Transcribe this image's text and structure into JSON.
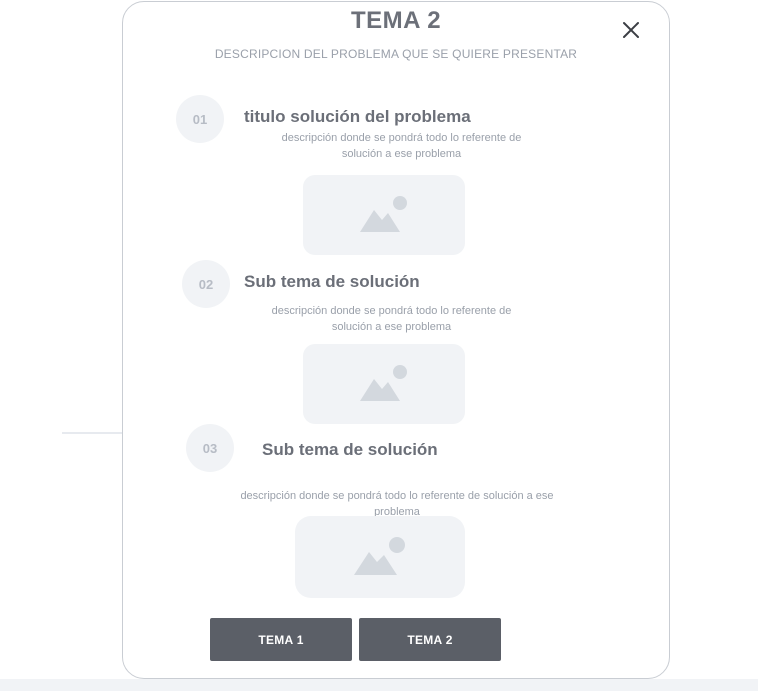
{
  "modal": {
    "title": "TEMA 2",
    "subtitle": "DESCRIPCION DEL PROBLEMA QUE SE QUIERE PRESENTAR",
    "close_icon": "close-icon"
  },
  "steps": [
    {
      "number": "01",
      "title": "titulo solución del problema",
      "description": "descripción  donde se pondrá todo lo referente de solución a ese problema",
      "image_icon": "image-placeholder-icon"
    },
    {
      "number": "02",
      "title": "Sub tema de solución",
      "description": "descripción  donde se pondrá todo lo referente de solución a ese problema",
      "image_icon": "image-placeholder-icon"
    },
    {
      "number": "03",
      "title": "Sub tema de solución",
      "description": "descripción  donde se pondrá todo lo referente de solución a ese problema",
      "image_icon": "image-placeholder-icon"
    }
  ],
  "buttons": {
    "tema1_label": "TEMA 1",
    "tema2_label": "TEMA 2"
  },
  "colors": {
    "button_bg": "#5b5f67",
    "placeholder_bg": "#f1f3f6",
    "title_text": "#6c7079",
    "muted_text": "#9aa0aa"
  }
}
